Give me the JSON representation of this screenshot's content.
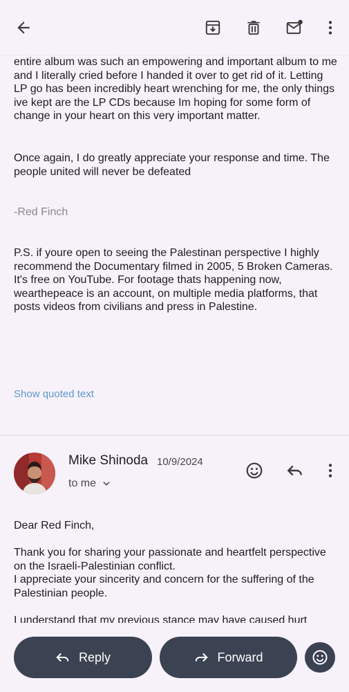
{
  "message1": {
    "paragraphs": [
      "entire album was such an empowering and important album to me and I literally cried before I handed it over to get rid of it. Letting LP go has been incredibly heart wrenching for me, the only things ive kept are the LP CDs because Im hoping for some form of change in your heart on this very important matter.",
      "Once again, I do greatly appreciate your response and time. The people united will never be defeated",
      "-Red Finch",
      "P.S. if youre open to seeing the Palestinan perspective I highly recommend the Documentary filmed in 2005, 5 Broken Cameras. It's free on YouTube. For footage thats happening now, wearthepeace is an account, on multiple media platforms, that posts videos from civilians and press in Palestine."
    ],
    "show_quoted": "Show quoted text"
  },
  "message2": {
    "sender": "Mike Shinoda",
    "date": "10/9/2024",
    "recipient": "to me",
    "paragraphs": [
      "Dear Red Finch,",
      "Thank you for sharing your passionate and heartfelt perspective on the Israeli-Palestinian conflict.\nI appreciate your sincerity and concern for the suffering of the Palestinian people.",
      "I understand that my previous stance may have caused hurt"
    ]
  },
  "actions": {
    "reply": "Reply",
    "forward": "Forward"
  },
  "icons": {
    "back": "arrow-back-icon",
    "archive": "archive-icon",
    "delete": "trash-icon",
    "unread": "mark-unread-icon",
    "more": "more-vert-icon",
    "emoji": "emoji-icon",
    "reply": "reply-icon",
    "forward": "forward-icon"
  },
  "colors": {
    "background": "#f7f2fa",
    "button": "#3b4252",
    "link": "#5e97c9",
    "signature": "#8a8690"
  }
}
